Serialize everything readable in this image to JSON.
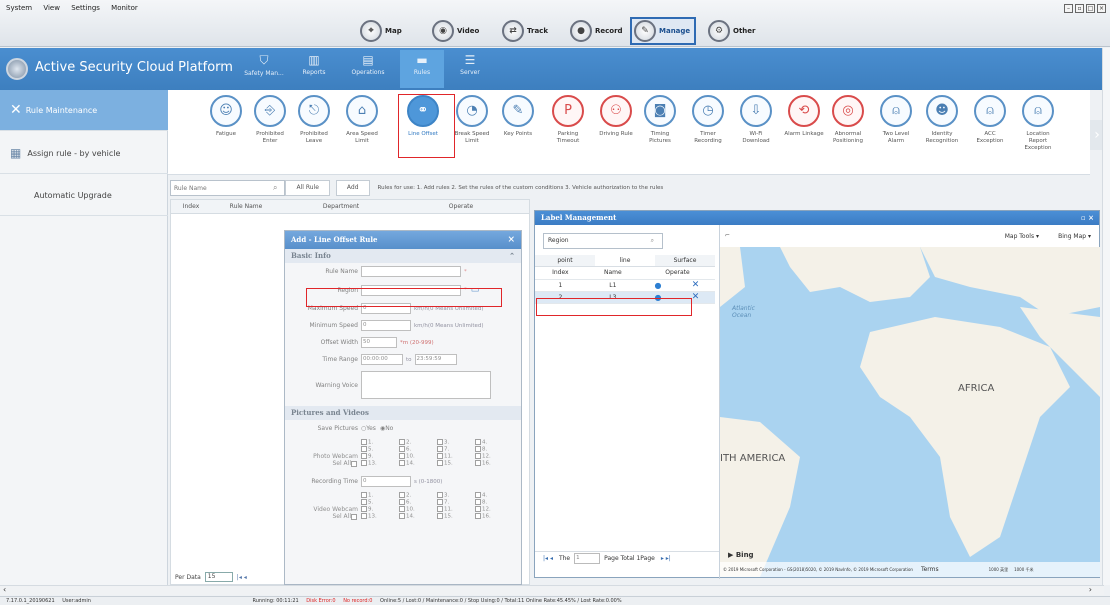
{
  "menubar": [
    "System",
    "View",
    "Settings",
    "Monitor"
  ],
  "nav_tabs": [
    {
      "label": "Map",
      "icon": "map-icon"
    },
    {
      "label": "Video",
      "icon": "video-icon"
    },
    {
      "label": "Track",
      "icon": "track-icon"
    },
    {
      "label": "Record",
      "icon": "record-icon"
    },
    {
      "label": "Manage",
      "icon": "manage-icon",
      "active": true
    },
    {
      "label": "Other",
      "icon": "other-icon"
    }
  ],
  "platform": {
    "title": "Active Security Cloud Platform",
    "tabs": [
      {
        "label": "Safety Man...",
        "icon": "shield-icon"
      },
      {
        "label": "Reports",
        "icon": "chart-icon"
      },
      {
        "label": "Operations",
        "icon": "document-icon"
      },
      {
        "label": "Rules",
        "icon": "rules-icon",
        "active": true
      },
      {
        "label": "Server",
        "icon": "server-icon"
      }
    ]
  },
  "sidebar": [
    {
      "label": "Rule Maintenance",
      "icon": "wrench-icon",
      "active": true
    },
    {
      "label": "Assign rule - by vehicle",
      "icon": "vehicle-list-icon"
    },
    {
      "label": "Automatic Upgrade",
      "icon": ""
    }
  ],
  "rules": [
    {
      "label": "Fatigue",
      "icon": "face-icon"
    },
    {
      "label": "Prohibited Enter",
      "icon": "no-entry-icon"
    },
    {
      "label": "Prohibited Leave",
      "icon": "no-leave-icon"
    },
    {
      "label": "Area Speed Limit",
      "icon": "area-speed-icon"
    },
    {
      "label": "Line Offset",
      "icon": "line-offset-icon",
      "selected": true
    },
    {
      "label": "Break Speed Limit",
      "icon": "speedometer-icon"
    },
    {
      "label": "Key Points",
      "icon": "key-points-icon"
    },
    {
      "label": "Parking Timeout",
      "icon": "parking-icon",
      "red": true
    },
    {
      "label": "Driving Rule",
      "icon": "driving-icon",
      "red": true
    },
    {
      "label": "Timing Pictures",
      "icon": "camera-icon"
    },
    {
      "label": "Timer Recording",
      "icon": "timer-icon"
    },
    {
      "label": "Wi-Fi Download",
      "icon": "download-icon"
    },
    {
      "label": "Alarm Linkage",
      "icon": "alarm-link-icon",
      "red": true
    },
    {
      "label": "Abnormal Positioning",
      "icon": "position-icon",
      "red": true
    },
    {
      "label": "Two Level Alarm",
      "icon": "alarm-icon"
    },
    {
      "label": "Identity Recognition",
      "icon": "identity-icon"
    },
    {
      "label": "ACC Exception",
      "icon": "acc-icon"
    },
    {
      "label": "Location Report Exception",
      "icon": "location-icon"
    }
  ],
  "toolbar": {
    "search_placeholder": "Rule Name",
    "all_rule": "All Rule",
    "add": "Add",
    "hint": "Rules for use: 1. Add rules 2. Set the rules of the custom conditions 3. Vehicle authorization to the rules"
  },
  "grid": {
    "headers": [
      "Index",
      "Rule Name",
      "Department",
      "Operate"
    ]
  },
  "pager": {
    "per_data": "Per Data",
    "per_value": "15"
  },
  "dialog": {
    "title": "Add - Line Offset Rule",
    "basic_info": "Basic Info",
    "rule_name": "Rule Name",
    "region": "Region",
    "max_speed": "Maximum Speed",
    "max_speed_val": "0",
    "max_speed_unit": "km/h(0 Means Unlimited)",
    "min_speed": "Minimum Speed",
    "min_speed_val": "0",
    "min_speed_unit": "km/h(0 Means Unlimited)",
    "offset_width": "Offset Width",
    "offset_width_val": "50",
    "offset_width_unit": "*m (20-999)",
    "time_range": "Time Range",
    "time_from": "00:00:00",
    "time_to_label": "to",
    "time_to": "23:59:59",
    "warning_voice": "Warning Voice",
    "pictures_videos": "Pictures and Videos",
    "save_pictures": "Save Pictures",
    "yes": "Yes",
    "no": "No",
    "photo_webcam": "Photo Webcam",
    "sel_all": "Sel All",
    "channels": [
      "1.",
      "2.",
      "3.",
      "4.",
      "5.",
      "6.",
      "7.",
      "8.",
      "9.",
      "10.",
      "11.",
      "12.",
      "13.",
      "14.",
      "15.",
      "16."
    ],
    "recording_time": "Recording Time",
    "recording_val": "0",
    "recording_unit": "s (0-1800)",
    "video_webcam": "Video Webcam"
  },
  "label_panel": {
    "title": "Label Management",
    "search_value": "Region",
    "tabs": [
      "point",
      "line",
      "Surface"
    ],
    "headers": [
      "Index",
      "Name",
      "Operate"
    ],
    "rows": [
      {
        "index": "1",
        "name": "L1"
      },
      {
        "index": "2",
        "name": "L3"
      }
    ],
    "pager": {
      "the": "The",
      "page_val": "1",
      "page_total": "Page Total 1Page"
    }
  },
  "map": {
    "tools": "Map Tools",
    "provider": "Bing Map",
    "labels": {
      "atlantic": "Atlantic Ocean",
      "africa": "AFRICA",
      "south_america": "ITH AMERICA"
    },
    "bing": "Bing",
    "copyright": "© 2019 Microsoft Corporation - GS(2018)5020, © 2019 NavInfo, © 2019 Microsoft Corporation",
    "terms": "Terms",
    "scale_km": "1000 英里",
    "scale_mi": "1000 千米"
  },
  "status": {
    "version": "7.17.0.1_20190621",
    "user": "User:admin",
    "running": "Running: 00:11:21",
    "disk": "Disk Error:0",
    "norecord": "No record:0",
    "online": "Online:5 / Lost:0 / Maintenance:0 / Stop Using:0 / Total:11   Online Rate:45.45% / Lost Rate:0.00%"
  }
}
